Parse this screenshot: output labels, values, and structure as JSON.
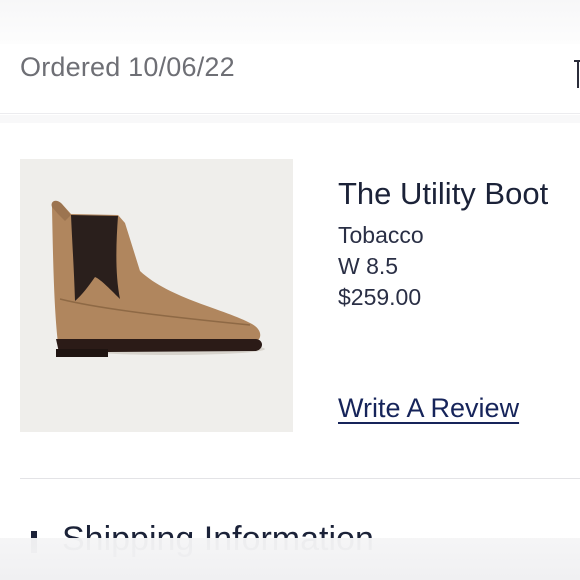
{
  "order": {
    "date_label": "Ordered 10/06/22"
  },
  "product": {
    "name": "The Utility Boot",
    "color": "Tobacco",
    "size": "W 8.5",
    "price": "$259.00",
    "review_label": "Write A Review",
    "image_alt": "The Utility Boot"
  },
  "shipping": {
    "heading": "Shipping Information"
  },
  "colors": {
    "text_primary": "#1b2238",
    "text_muted": "#6e6f75",
    "link": "#16245a",
    "boot_upper": "#b0865e",
    "boot_panel": "#2a1f1c",
    "boot_sole": "#2b1b17",
    "image_background": "#efeeeb"
  },
  "icons": {
    "header_edge": "menu-edge-icon",
    "section_bullet": "bullet-icon"
  }
}
